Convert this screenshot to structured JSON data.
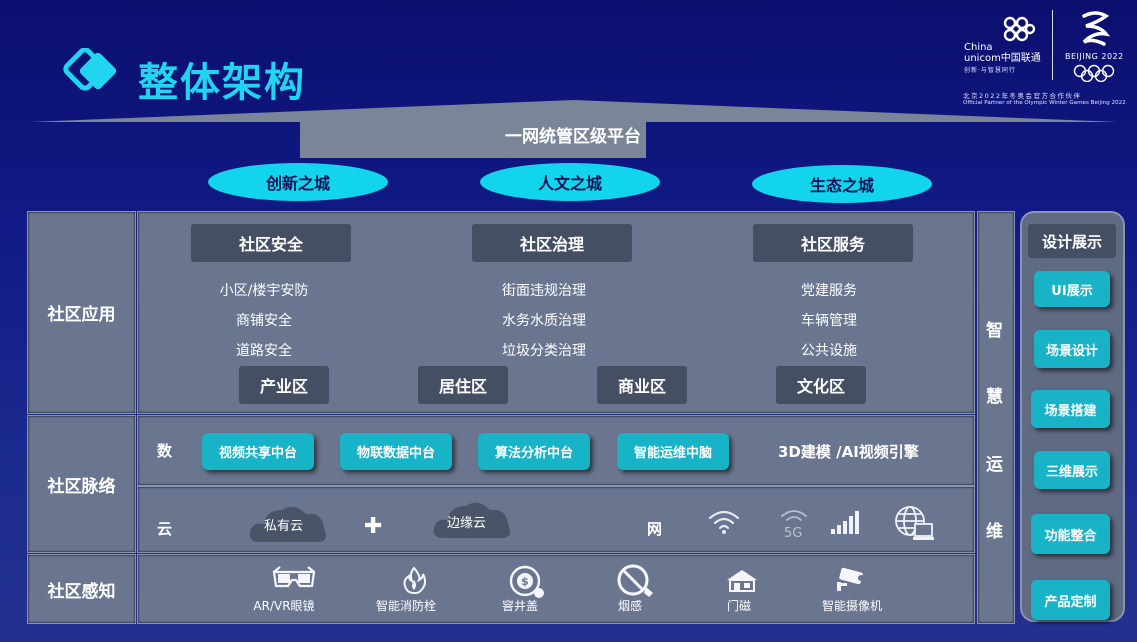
{
  "header": {
    "title": "整体架构"
  },
  "partner": {
    "brand_cn": "China\nunicom中国联通",
    "tagline": "创新·与智慧同行",
    "beijing": "BEIJING 2022",
    "official_cn": "北京2022年冬奥会官方合作伙伴",
    "official_en": "Official Partner of the Olympic Winter Games Beijing 2022"
  },
  "platform": {
    "label": "一网统管区级平台"
  },
  "cities": [
    "创新之城",
    "人文之城",
    "生态之城"
  ],
  "application": {
    "label": "社区应用",
    "categories": [
      {
        "name": "社区安全",
        "items": [
          "小区/楼宇安防",
          "商铺安全",
          "道路安全"
        ]
      },
      {
        "name": "社区治理",
        "items": [
          "街面违规治理",
          "水务水质治理",
          "垃圾分类治理"
        ]
      },
      {
        "name": "社区服务",
        "items": [
          "党建服务",
          "车辆管理",
          "公共设施"
        ]
      }
    ],
    "zones": [
      "产业区",
      "居住区",
      "商业区",
      "文化区"
    ]
  },
  "network": {
    "label": "社区脉络",
    "data_label": "数",
    "platforms": [
      "视频共享中台",
      "物联数据中台",
      "算法分析中台",
      "智能运维中脑"
    ],
    "engine": "3D建模 /AI视频引擎",
    "cloud_label": "云",
    "private_cloud": "私有云",
    "plus": "✚",
    "edge_cloud": "边缘云",
    "net_label": "网",
    "net_icons": [
      "wifi-icon",
      "5g-icon",
      "signal-bars-icon",
      "globe-computer-icon"
    ],
    "five_g": "5G"
  },
  "perception": {
    "label": "社区感知",
    "devices": [
      {
        "icon": "vr-glasses-icon",
        "label": "AR/VR眼镜"
      },
      {
        "icon": "fire-hydrant-icon",
        "label": "智能消防栓"
      },
      {
        "icon": "manhole-cover-icon",
        "label": "窨井盖"
      },
      {
        "icon": "no-smoking-icon",
        "label": "烟感"
      },
      {
        "icon": "house-door-icon",
        "label": "门磁"
      },
      {
        "icon": "camera-icon",
        "label": "智能摄像机"
      }
    ]
  },
  "ops": {
    "chars": [
      "智",
      "慧",
      "运",
      "维"
    ]
  },
  "design": {
    "title": "设计展示",
    "items": [
      "UI展示",
      "场景设计",
      "场景搭建",
      "三维展示",
      "功能整合",
      "产品定制"
    ]
  },
  "colors": {
    "accent": "#21d4f0",
    "cyan": "#18b3c7",
    "panel": "#6a7690",
    "dark_tag": "#454f63",
    "bg": "#111a86"
  }
}
